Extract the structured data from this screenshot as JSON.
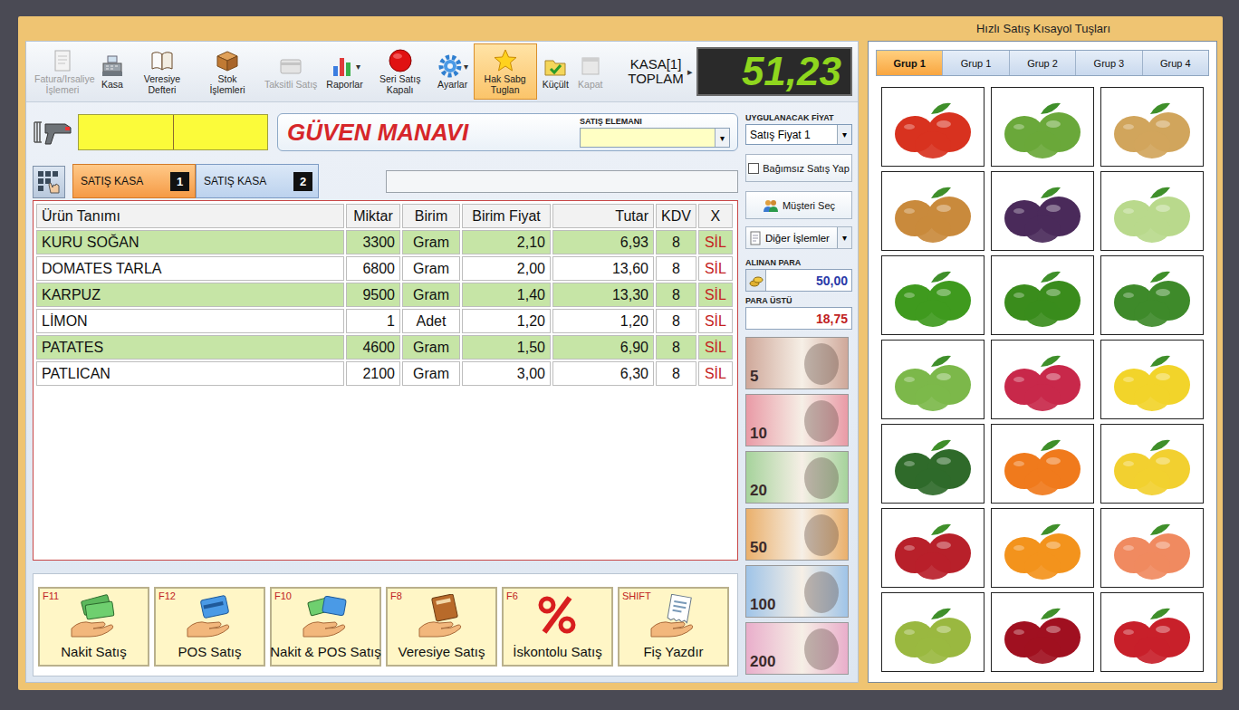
{
  "toolbar": {
    "items": [
      {
        "label": "Fatura/Irsaliye İşlemeri",
        "disabled": true,
        "selected": false
      },
      {
        "label": "Kasa",
        "disabled": false,
        "selected": false
      },
      {
        "label": "Veresiye Defteri",
        "disabled": false,
        "selected": false
      },
      {
        "label": "Stok İşlemleri",
        "disabled": false,
        "selected": false
      },
      {
        "label": "Taksitli Satış",
        "disabled": true,
        "selected": false
      },
      {
        "label": "Raporlar",
        "disabled": false,
        "selected": false,
        "arrow": "▾"
      },
      {
        "label": "Seri Satış Kapalı",
        "disabled": false,
        "selected": false
      },
      {
        "label": "Ayarlar",
        "disabled": false,
        "selected": false,
        "arrow": "▾"
      },
      {
        "label": "Hak Sabg Tuglan",
        "disabled": false,
        "selected": true
      },
      {
        "label": "Küçült",
        "disabled": false,
        "selected": false
      },
      {
        "label": "Kapat",
        "disabled": true,
        "selected": false
      }
    ],
    "total_label": "KASA[1] TOPLAM",
    "total_arrow": "▸",
    "total": "51,23"
  },
  "store": {
    "name": "GÜVEN MANAVI",
    "sales_person_label": "SATIŞ ELEMANI",
    "sales_person_arrow": "▾"
  },
  "kasa_tabs": [
    {
      "label": "SATIŞ KASA",
      "badge": "1",
      "selected": true
    },
    {
      "label": "SATIŞ KASA",
      "badge": "2",
      "selected": false
    }
  ],
  "table": {
    "columns": [
      "Ürün Tanımı",
      "Miktar",
      "Birim",
      "Birim Fiyat",
      "Tutar",
      "KDV",
      "X"
    ],
    "rows": [
      [
        "KURU SOĞAN",
        "3300",
        "Gram",
        "2,10",
        "6,93",
        "8",
        "SİL"
      ],
      [
        "DOMATES TARLA",
        "6800",
        "Gram",
        "2,00",
        "13,60",
        "8",
        "SİL"
      ],
      [
        "KARPUZ",
        "9500",
        "Gram",
        "1,40",
        "13,30",
        "8",
        "SİL"
      ],
      [
        "LİMON",
        "1",
        "Adet",
        "1,20",
        "1,20",
        "8",
        "SİL"
      ],
      [
        "PATATES",
        "4600",
        "Gram",
        "1,50",
        "6,90",
        "8",
        "SİL"
      ],
      [
        "PATLICAN",
        "2100",
        "Gram",
        "3,00",
        "6,30",
        "8",
        "SİL"
      ]
    ]
  },
  "side": {
    "price_label": "UYGULANACAK FİYAT",
    "price_value": "Satış Fiyat 1",
    "price_arrow": "▾",
    "independent_sale": {
      "label": "Bağımsız Satış Yap",
      "checked": false
    },
    "customer_button": "Müşteri Seç",
    "other_button": "Diğer İşlemler",
    "other_arrow": "▾",
    "received_label": "ALINAN PARA",
    "received": "50,00",
    "change_label": "PARA ÜSTÜ",
    "change": "18,75",
    "banknotes": [
      {
        "value": "5",
        "color": "#cfa89a"
      },
      {
        "value": "10",
        "color": "#e99aa6"
      },
      {
        "value": "20",
        "color": "#a6d39c"
      },
      {
        "value": "50",
        "color": "#eab06c"
      },
      {
        "value": "100",
        "color": "#9fc4e8"
      },
      {
        "value": "200",
        "color": "#e9aecb"
      }
    ]
  },
  "actions": [
    {
      "key": "F11",
      "label": "Nakit Satış"
    },
    {
      "key": "F12",
      "label": "POS Satış"
    },
    {
      "key": "F10",
      "label": "Nakit & POS Satış"
    },
    {
      "key": "F8",
      "label": "Veresiye Satış"
    },
    {
      "key": "F6",
      "label": "İskontolu Satış"
    },
    {
      "key": "SHIFT",
      "label": "Fiş Yazdır"
    }
  ],
  "quick": {
    "title": "Hızlı Satış Kısayol Tuşları",
    "tabs": [
      {
        "label": "Grup 1",
        "selected": true
      },
      {
        "label": "Grup 1",
        "selected": false
      },
      {
        "label": "Grup 2",
        "selected": false
      },
      {
        "label": "Grup 3",
        "selected": false
      },
      {
        "label": "Grup 4",
        "selected": false
      }
    ],
    "tiles": [
      {
        "color": "#d8321f"
      },
      {
        "color": "#6aa83a"
      },
      {
        "color": "#d1a55c"
      },
      {
        "color": "#c98a3c"
      },
      {
        "color": "#4a2a5a"
      },
      {
        "color": "#b9d98c"
      },
      {
        "color": "#3f9a1e"
      },
      {
        "color": "#3a8c1c"
      },
      {
        "color": "#3e8a2a"
      },
      {
        "color": "#7cb84a"
      },
      {
        "color": "#c8284a"
      },
      {
        "color": "#f2d42a"
      },
      {
        "color": "#2f6a2a"
      },
      {
        "color": "#f07a1c"
      },
      {
        "color": "#f2d030"
      },
      {
        "color": "#b8202a"
      },
      {
        "color": "#f3931c"
      },
      {
        "color": "#f08a60"
      },
      {
        "color": "#9ab840"
      },
      {
        "color": "#a01020"
      },
      {
        "color": "#c8202a"
      }
    ]
  }
}
